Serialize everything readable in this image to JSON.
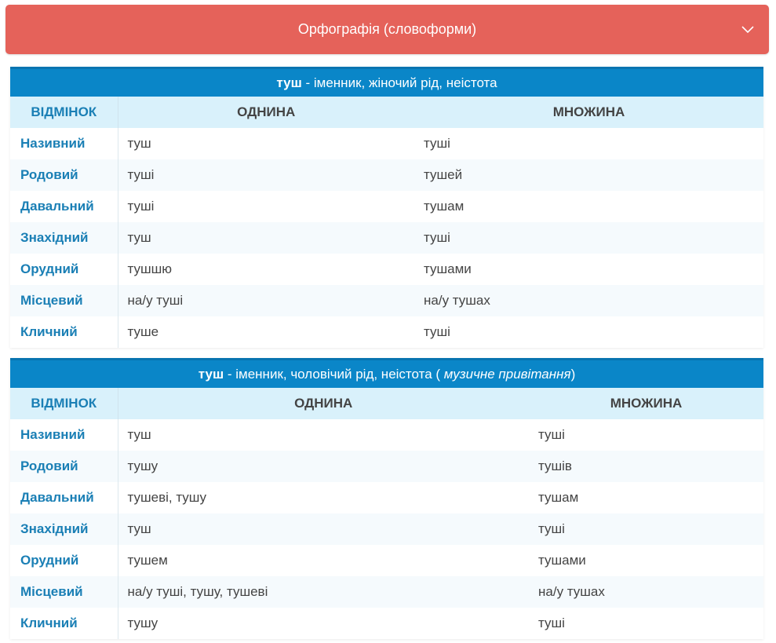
{
  "accordion": {
    "title": "Орфографія (словоформи)",
    "expanded": true
  },
  "tables": [
    {
      "word": "туш",
      "description": " - іменник, жіночий рід, неістота",
      "note": "",
      "closing": "",
      "headers": {
        "case": "ВІДМІНОК",
        "singular": "ОДНИНА",
        "plural": "МНОЖИНА"
      },
      "rows": [
        {
          "case": "Називний",
          "singular": "туш",
          "plural": "туші"
        },
        {
          "case": "Родовий",
          "singular": "туші",
          "plural": "тушей"
        },
        {
          "case": "Давальний",
          "singular": "туші",
          "plural": "тушам"
        },
        {
          "case": "Знахідний",
          "singular": "туш",
          "plural": "туші"
        },
        {
          "case": "Орудний",
          "singular": "тушшю",
          "plural": "тушами"
        },
        {
          "case": "Місцевий",
          "singular": "на/у туші",
          "plural": "на/у тушах"
        },
        {
          "case": "Кличний",
          "singular": "туше",
          "plural": "туші"
        }
      ]
    },
    {
      "word": "туш",
      "description": " - іменник, чоловічий рід, неістота ( ",
      "note": "музичне привітання",
      "closing": ")",
      "headers": {
        "case": "ВІДМІНОК",
        "singular": "ОДНИНА",
        "plural": "МНОЖИНА"
      },
      "rows": [
        {
          "case": "Називний",
          "singular": "туш",
          "plural": "туші"
        },
        {
          "case": "Родовий",
          "singular": "тушу",
          "plural": "тушів"
        },
        {
          "case": "Давальний",
          "singular": "тушеві, тушу",
          "plural": "тушам"
        },
        {
          "case": "Знахідний",
          "singular": "туш",
          "plural": "туші"
        },
        {
          "case": "Орудний",
          "singular": "тушем",
          "plural": "тушами"
        },
        {
          "case": "Місцевий",
          "singular": "на/у туші, тушу, тушеві",
          "plural": "на/у тушах"
        },
        {
          "case": "Кличний",
          "singular": "тушу",
          "plural": "туші"
        }
      ]
    }
  ]
}
